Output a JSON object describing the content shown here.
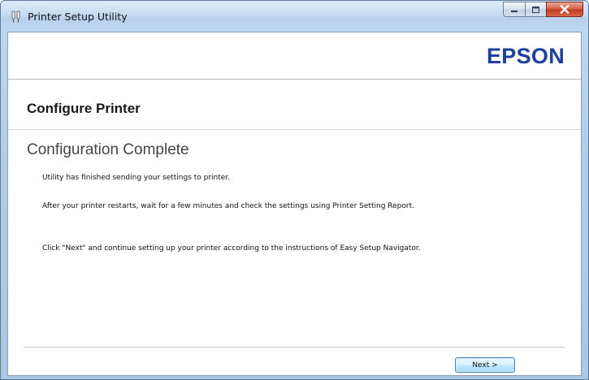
{
  "window": {
    "title": "Printer Setup Utility",
    "controls": {
      "minimize_icon": "minimize-icon",
      "maximize_icon": "maximize-icon",
      "close_icon": "close-icon"
    }
  },
  "header": {
    "logo_text": "EPSON",
    "logo_color": "#1e3f9d"
  },
  "section": {
    "title": "Configure Printer"
  },
  "page": {
    "heading": "Configuration Complete",
    "paragraphs": [
      "Utility has finished sending your settings to printer.",
      "After your printer restarts, wait for a few minutes and check the settings using Printer Setting Report.",
      "Click \"Next\" and continue setting up your printer according to the instructions of Easy Setup Navigator."
    ]
  },
  "footer": {
    "next_label": "Next >"
  }
}
